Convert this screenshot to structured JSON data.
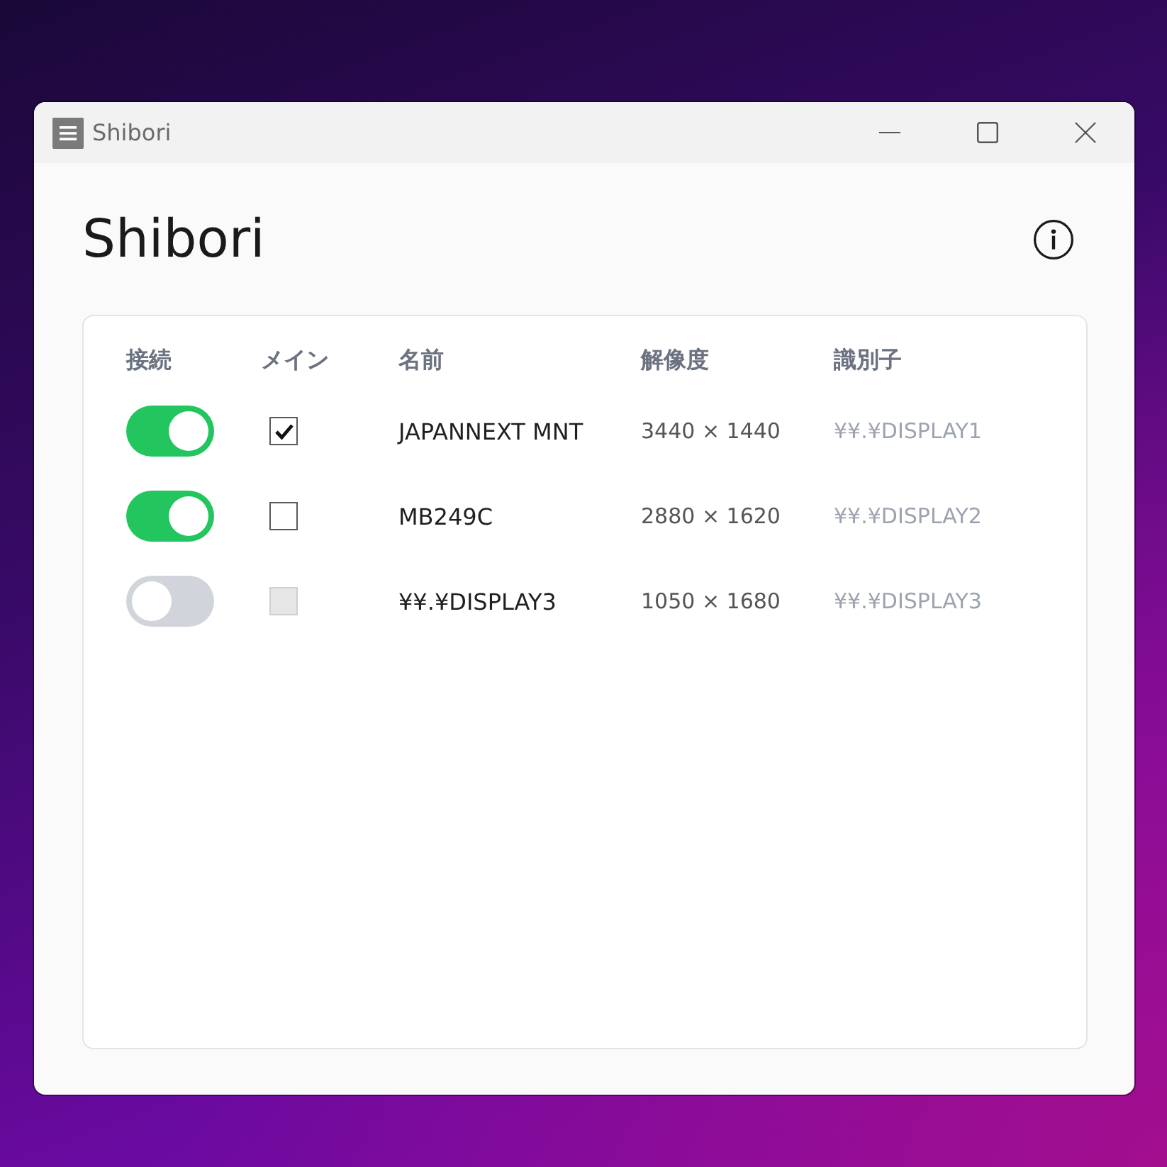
{
  "window": {
    "title": "Shibori"
  },
  "heading": "Shibori",
  "table": {
    "columns": [
      "接続",
      "メイン",
      "名前",
      "解像度",
      "識別子"
    ],
    "rows": [
      {
        "connected": true,
        "main": true,
        "main_disabled": false,
        "name": "JAPANNEXT MNT",
        "resolution": "3440 × 1440",
        "identifier": "¥¥.¥DISPLAY1"
      },
      {
        "connected": true,
        "main": false,
        "main_disabled": false,
        "name": "MB249C",
        "resolution": "2880 × 1620",
        "identifier": "¥¥.¥DISPLAY2"
      },
      {
        "connected": false,
        "main": false,
        "main_disabled": true,
        "name": "¥¥.¥DISPLAY3",
        "resolution": "1050 × 1680",
        "identifier": "¥¥.¥DISPLAY3"
      }
    ]
  }
}
